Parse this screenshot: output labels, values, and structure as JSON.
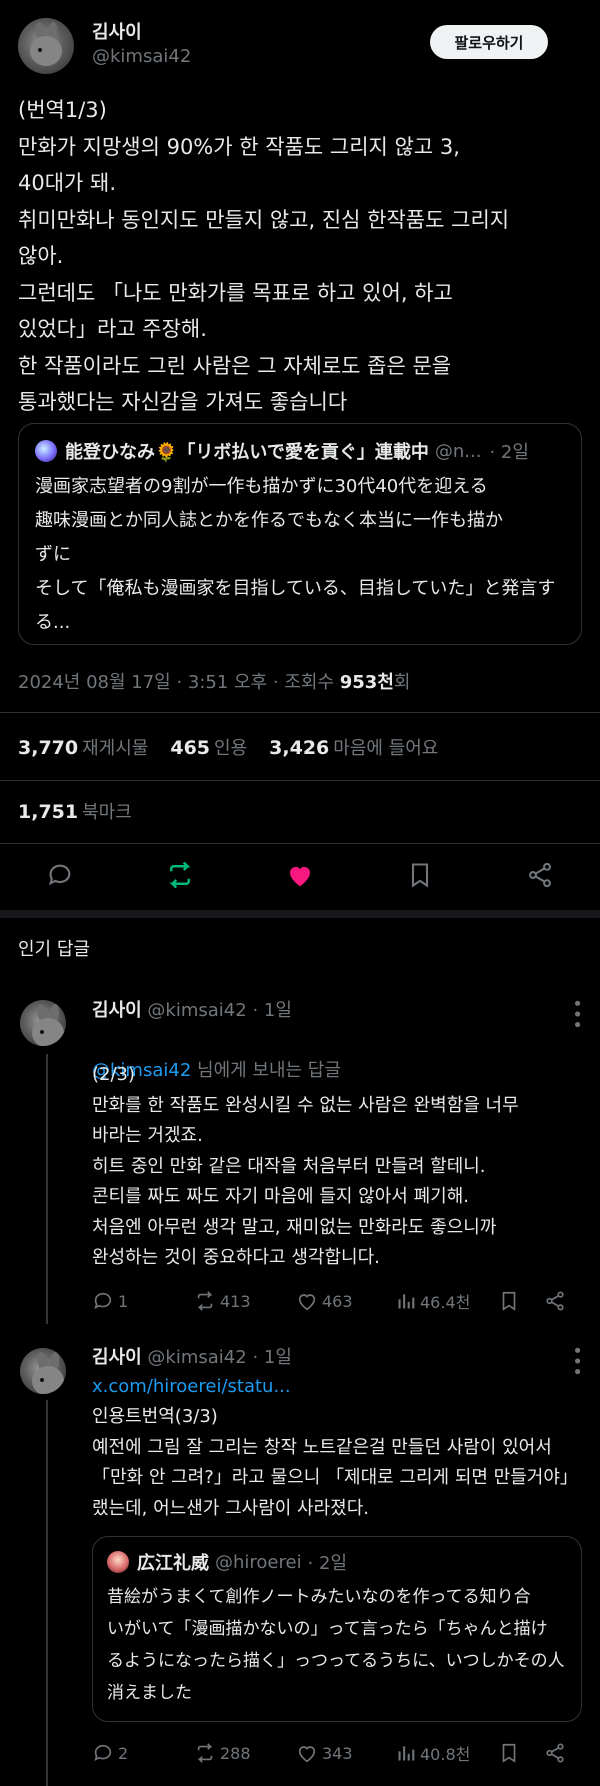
{
  "author": {
    "name": "김사이",
    "handle": "@kimsai42",
    "follow_label": "팔로우하기"
  },
  "tweet": {
    "text": "(번역1/3)\n만화가 지망생의 90%가 한 작품도 그리지 않고 3,\n40대가 돼.\n취미만화나 동인지도 만들지 않고, 진심 한작품도 그리지\n않아.\n그런데도 「나도 만화가를 목표로 하고 있어, 하고\n있었다」라고 주장해.\n한 작품이라도 그린 사람은 그 자체로도 좁은 문을\n통과했다는 자신감을 가져도 좋습니다",
    "quote": {
      "name": "能登ひなみ🌻「リボ払いで愛を貢ぐ」連載中",
      "handle": "@n...",
      "time": "· 2일",
      "text": "漫画家志望者の9割が一作も描かずに30代40代を迎える\n趣味漫画とか同人誌とかを作るでもなく本当に一作も描か\nずに\nそして「俺私も漫画家を目指している、目指していた」と発言す\nる..."
    },
    "meta_date": "2024년 08월 17일 · 3:51 오후 · 조회수",
    "meta_views": "953천",
    "meta_views_suffix": "회",
    "stats": {
      "retweets": "3,770",
      "retweets_label": "재게시물",
      "quotes": "465",
      "quotes_label": "인용",
      "likes": "3,426",
      "likes_label": "마음에 들어요",
      "bookmarks": "1,751",
      "bookmarks_label": "북마크"
    }
  },
  "replies_title": "인기 답글",
  "replies": [
    {
      "name": "김사이",
      "handle": "@kimsai42",
      "time": "· 1일",
      "reply_to_handle": "@kimsai42",
      "reply_to_suffix": " 님에게 보내는 답글",
      "text": "(2/3)\n만화를 한 작품도 완성시킬 수 없는 사람은 완벽함을 너무\n바라는 거겠죠.\n히트 중인 만화 같은 대작을 처음부터 만들려 할테니.\n콘티를 짜도 짜도 자기 마음에 들지 않아서 폐기해.\n처음엔 아무런 생각 말고, 재미없는 만화라도 좋으니까\n완성하는 것이 중요하다고 생각합니다.",
      "replies": "1",
      "retweets": "413",
      "likes": "463",
      "views": "46.4천"
    },
    {
      "name": "김사이",
      "handle": "@kimsai42",
      "time": "· 1일",
      "link": "x.com/hiroerei/statu...",
      "text": "인용트번역(3/3)\n예전에 그림 잘 그리는 창작 노트같은걸 만들던 사람이 있어서\n「만화 안 그려?」라고 물으니 「제대로 그리게 되면 만들거야」\n랬는데, 어느샌가 그사람이 사라졌다.",
      "quote": {
        "name": "広江礼威",
        "handle": "@hiroerei",
        "time": "· 2일",
        "text": "昔絵がうまくて創作ノートみたいなのを作ってる知り合\nいがいて「漫画描かないの」って言ったら「ちゃんと描け\nるようになったら描く」っつってるうちに、いつしかその人\n消えました"
      },
      "replies": "2",
      "retweets": "288",
      "likes": "343",
      "views": "40.8천"
    }
  ],
  "colors": {
    "background": "#000000",
    "text": "#e7e9ea",
    "muted": "#71767b",
    "link": "#1d9bf0",
    "retweet_green": "#00ba7c",
    "like_pink": "#f91880"
  }
}
